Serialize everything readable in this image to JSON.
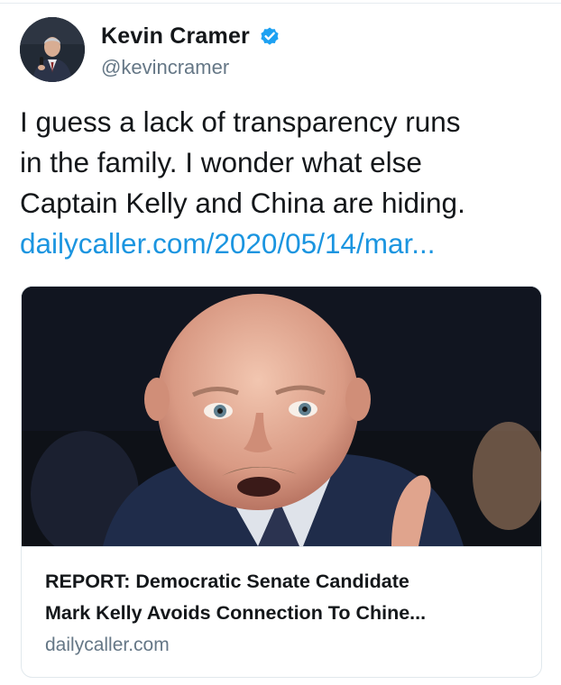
{
  "author": {
    "name": "Kevin Cramer",
    "handle": "@kevincramer",
    "verified_icon": "verified-badge-icon"
  },
  "tweet": {
    "text_lines": [
      "I guess a lack of transparency runs",
      "in the family. I wonder what else",
      "Captain Kelly and China are hiding."
    ],
    "link": "dailycaller.com/2020/05/14/mar..."
  },
  "card": {
    "title_lines": [
      "REPORT: Democratic Senate Candidate",
      "Mark Kelly Avoids Connection To Chine..."
    ],
    "domain": "dailycaller.com"
  },
  "colors": {
    "link": "#1b95e0",
    "verified": "#1da1f2",
    "secondary_text": "#657786",
    "border": "#e1e8ed"
  }
}
